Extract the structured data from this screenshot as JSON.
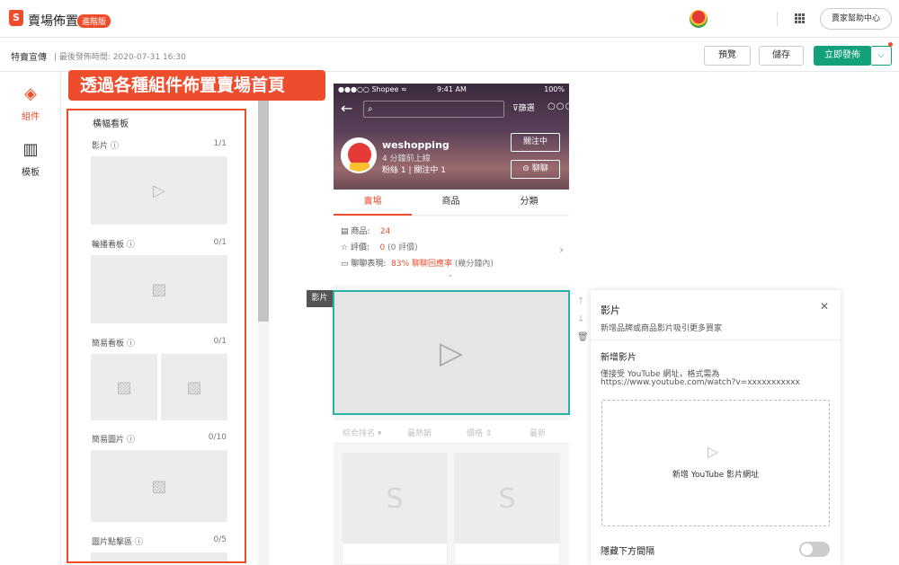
{
  "header": {
    "logo": "S",
    "title": "賣場佈置",
    "badge": "進階版",
    "help_label": "賣家幫助中心"
  },
  "subheader": {
    "page_name": "特賣宣傳",
    "publish_time": "| 最後發佈時間: 2020-07-31 16:30",
    "preview_label": "預覽",
    "save_label": "儲存",
    "publish_label": "立即發佈",
    "dropdown_glyph": "⌵"
  },
  "leftnav": {
    "items": [
      {
        "label": "組件",
        "icon": "layers-icon",
        "glyph": "◈"
      },
      {
        "label": "模板",
        "icon": "template-icon",
        "glyph": "▥"
      }
    ]
  },
  "callout": "透過各種組件佈置賣場首頁",
  "component_panel": {
    "title": "橫幅看板",
    "widgets": [
      {
        "label": "影片 ⓘ",
        "count": "1/1"
      },
      {
        "label": "輪播看板 ⓘ",
        "count": "0/1"
      },
      {
        "label": "簡易看板 ⓘ",
        "count": "0/1"
      },
      {
        "label": "簡易圖片 ⓘ",
        "count": "0/10"
      },
      {
        "label": "圖片點擊區 ⓘ",
        "count": "0/5"
      }
    ]
  },
  "phone": {
    "status_left": "●●●○○ Shopee ≈",
    "status_time": "9:41 AM",
    "status_right": "100%",
    "search_icon": "⌕",
    "filter_label": "篩選",
    "shop_name": "weshopping",
    "shop_sub": "4 分鐘前上線",
    "shop_stats": "粉絲 1 | 關注中 1",
    "follow_label": "關注中",
    "chat_label": "⊝ 聊聊",
    "tabs": [
      "賣場",
      "商品",
      "分類"
    ],
    "info": {
      "products_label": "商品:",
      "products_value": "24",
      "rating_label": "評價:",
      "rating_value": "0",
      "rating_note": "(0 評價)",
      "chat_label": "聊聊表現:",
      "chat_value": "83% 聊聊回應率",
      "chat_note": "(幾分鐘內)"
    },
    "sort": [
      "綜合排名 ▾",
      "最熱銷",
      "價格 ⇕",
      "最新"
    ],
    "product_bag": "S"
  },
  "video_tag": "影片",
  "settings_panel": {
    "title": "影片",
    "close": "✕",
    "desc": "新增品牌或商品影片吸引更多買家",
    "section": "新增影片",
    "hint1": "僅接受 YouTube 網址，格式需為",
    "hint2": "https://www.youtube.com/watch?v=xxxxxxxxxxx",
    "add_label": "新增 YouTube 影片網址",
    "toggle_label": "隱藏下方間隔",
    "toggle_on": false
  },
  "colors": {
    "brand": "#ee4d2d",
    "publish": "#12a17b",
    "selected_outline": "#26b3a0"
  }
}
